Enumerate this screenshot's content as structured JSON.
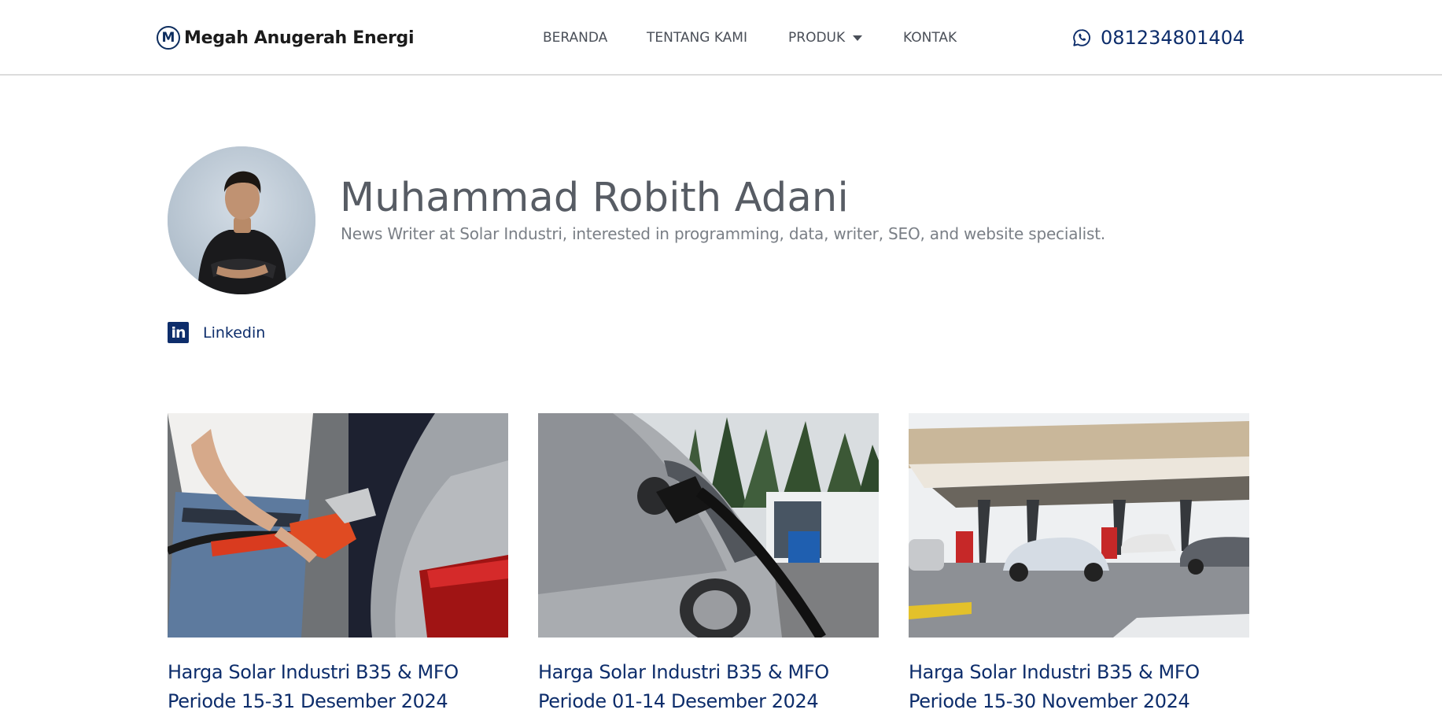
{
  "header": {
    "logo_letter": "M",
    "logo_text": "Megah Anugerah Energi",
    "nav": [
      {
        "label": "BERANDA"
      },
      {
        "label": "TENTANG KAMI"
      },
      {
        "label": "PRODUK",
        "has_dropdown": true
      },
      {
        "label": "KONTAK"
      }
    ],
    "phone": "081234801404",
    "phone_icon": "whatsapp-icon"
  },
  "author": {
    "name": "Muhammad Robith Adani",
    "bio": "News Writer at Solar Industri, interested in programming, data, writer, SEO, and website specialist.",
    "social": [
      {
        "icon": "linkedin-icon",
        "label": "Linkedin"
      }
    ]
  },
  "posts": [
    {
      "title": "Harga Solar Industri B35 & MFO Periode 15-31 Desember 2024"
    },
    {
      "title": "Harga Solar Industri B35 & MFO Periode 01-14 Desember 2024"
    },
    {
      "title": "Harga Solar Industri B35 & MFO Periode 15-30 November 2024"
    }
  ],
  "colors": {
    "brand_navy": "#0d2d6b",
    "nav_text": "#4a4f58",
    "name_text": "#575c64",
    "bio_text": "#7a7f86"
  }
}
